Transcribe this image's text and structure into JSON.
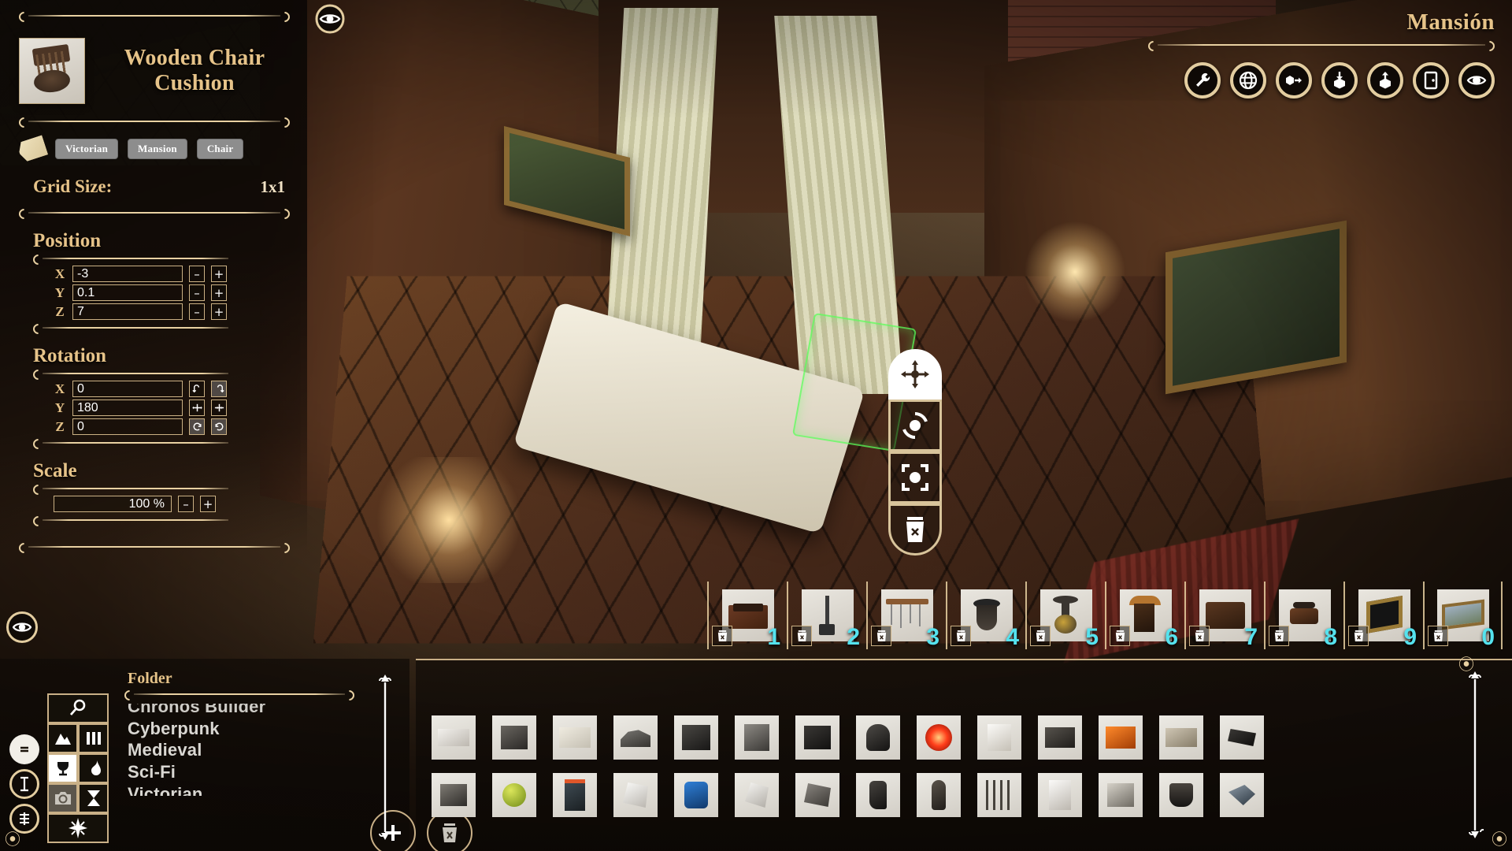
{
  "scene": {
    "title": "Mansión",
    "viewport_name": "3d-build-viewport"
  },
  "inspector": {
    "item_name_line1": "Wooden Chair",
    "item_name_line2": "Cushion",
    "thumbnail_name": "wooden-chair-cushion-thumbnail",
    "tags": [
      "Victorian",
      "Mansion",
      "Chair"
    ],
    "grid_size_label": "Grid Size:",
    "grid_size_value": "1x1",
    "position": {
      "title": "Position",
      "axes": [
        "X",
        "Y",
        "Z"
      ],
      "values": [
        "-3",
        "0.1",
        "7"
      ],
      "minus_label": "–",
      "plus_label": "+"
    },
    "rotation": {
      "title": "Rotation",
      "axes": [
        "X",
        "Y",
        "Z"
      ],
      "values": [
        "0",
        "180",
        "0"
      ]
    },
    "scale": {
      "title": "Scale",
      "value": "100 %",
      "minus_label": "–",
      "plus_label": "+"
    }
  },
  "toolbar_top_right": [
    {
      "name": "wrench-icon",
      "label": "Settings"
    },
    {
      "name": "globe-icon",
      "label": "World"
    },
    {
      "name": "box-export-icon",
      "label": "Export Object"
    },
    {
      "name": "download-icon",
      "label": "Load"
    },
    {
      "name": "upload-icon",
      "label": "Save"
    },
    {
      "name": "door-exit-icon",
      "label": "Exit"
    },
    {
      "name": "eye-icon",
      "label": "Toggle UI"
    }
  ],
  "gizmo_menu": [
    {
      "name": "move-icon",
      "label": "Move"
    },
    {
      "name": "rotate-icon",
      "label": "Rotate"
    },
    {
      "name": "scale-icon",
      "label": "Scale"
    },
    {
      "name": "delete-icon",
      "label": "Delete"
    }
  ],
  "hotbar": {
    "slots": [
      {
        "index": "1",
        "item": "washstand-cabinet"
      },
      {
        "index": "2",
        "item": "fireplace-shovel"
      },
      {
        "index": "3",
        "item": "utensil-rack"
      },
      {
        "index": "4",
        "item": "dark-urn"
      },
      {
        "index": "5",
        "item": "brass-vase"
      },
      {
        "index": "6",
        "item": "mantel-clock"
      },
      {
        "index": "7",
        "item": "wooden-chest"
      },
      {
        "index": "8",
        "item": "antique-telephone"
      },
      {
        "index": "9",
        "item": "gilded-frame"
      },
      {
        "index": "0",
        "item": "landscape-painting"
      }
    ],
    "remove_icon": "trash-icon"
  },
  "browser": {
    "left_rail_icons": [
      {
        "name": "equals-icon"
      },
      {
        "name": "vertical-scale-icon"
      },
      {
        "name": "layers-scale-icon"
      }
    ],
    "tool_buttons": [
      {
        "name": "search-icon",
        "state": "normal"
      },
      {
        "name": "mountain-icon",
        "state": "normal"
      },
      {
        "name": "pillars-icon",
        "state": "normal"
      },
      {
        "name": "goblet-icon",
        "state": "active"
      },
      {
        "name": "flame-icon",
        "state": "normal"
      },
      {
        "name": "camera-icon",
        "state": "disabled"
      },
      {
        "name": "hourglass-icon",
        "state": "normal"
      },
      {
        "name": "compass-star-icon",
        "state": "normal"
      }
    ],
    "folder_header": "Folder",
    "folders": [
      "Chronos Builder",
      "Cyberpunk",
      "Medieval",
      "Sci-Fi",
      "Victorian"
    ],
    "add_button_label": "+",
    "delete_button_icon": "trash-icon",
    "scrollbar_left_name": "folder-scrollbar",
    "scrollbar_right_name": "items-scrollbar"
  },
  "item_grid": {
    "rows": [
      [
        {
          "name": "white-console-unit"
        },
        {
          "name": "dark-cube-speaker"
        },
        {
          "name": "beige-server-box"
        },
        {
          "name": "exercise-bike"
        },
        {
          "name": "black-tower-pc"
        },
        {
          "name": "grey-cabinet"
        },
        {
          "name": "dark-crt-monitor"
        },
        {
          "name": "black-pod-chair"
        },
        {
          "name": "red-glowing-orb"
        },
        {
          "name": "white-appliance"
        },
        {
          "name": "dark-desk-unit"
        },
        {
          "name": "orange-machine"
        },
        {
          "name": "stone-block"
        },
        {
          "name": "black-device"
        }
      ],
      [
        {
          "name": "grey-scanner"
        },
        {
          "name": "green-apple"
        },
        {
          "name": "arcade-cabinet"
        },
        {
          "name": "white-office-chair"
        },
        {
          "name": "blue-seat"
        },
        {
          "name": "white-lab-chair"
        },
        {
          "name": "grey-recliner"
        },
        {
          "name": "black-boot"
        },
        {
          "name": "dark-figurine"
        },
        {
          "name": "rack-of-rods"
        },
        {
          "name": "white-tower-case"
        },
        {
          "name": "silver-machine"
        },
        {
          "name": "black-bucket"
        },
        {
          "name": "blue-grey-tool"
        }
      ]
    ]
  },
  "colors": {
    "accent_gold": "#e6c389",
    "frame_gold": "#e9d1a2",
    "hotbar_number": "#55e2ee",
    "tag_button": "#8d8d8d",
    "panel_bg": "#0e0906"
  }
}
